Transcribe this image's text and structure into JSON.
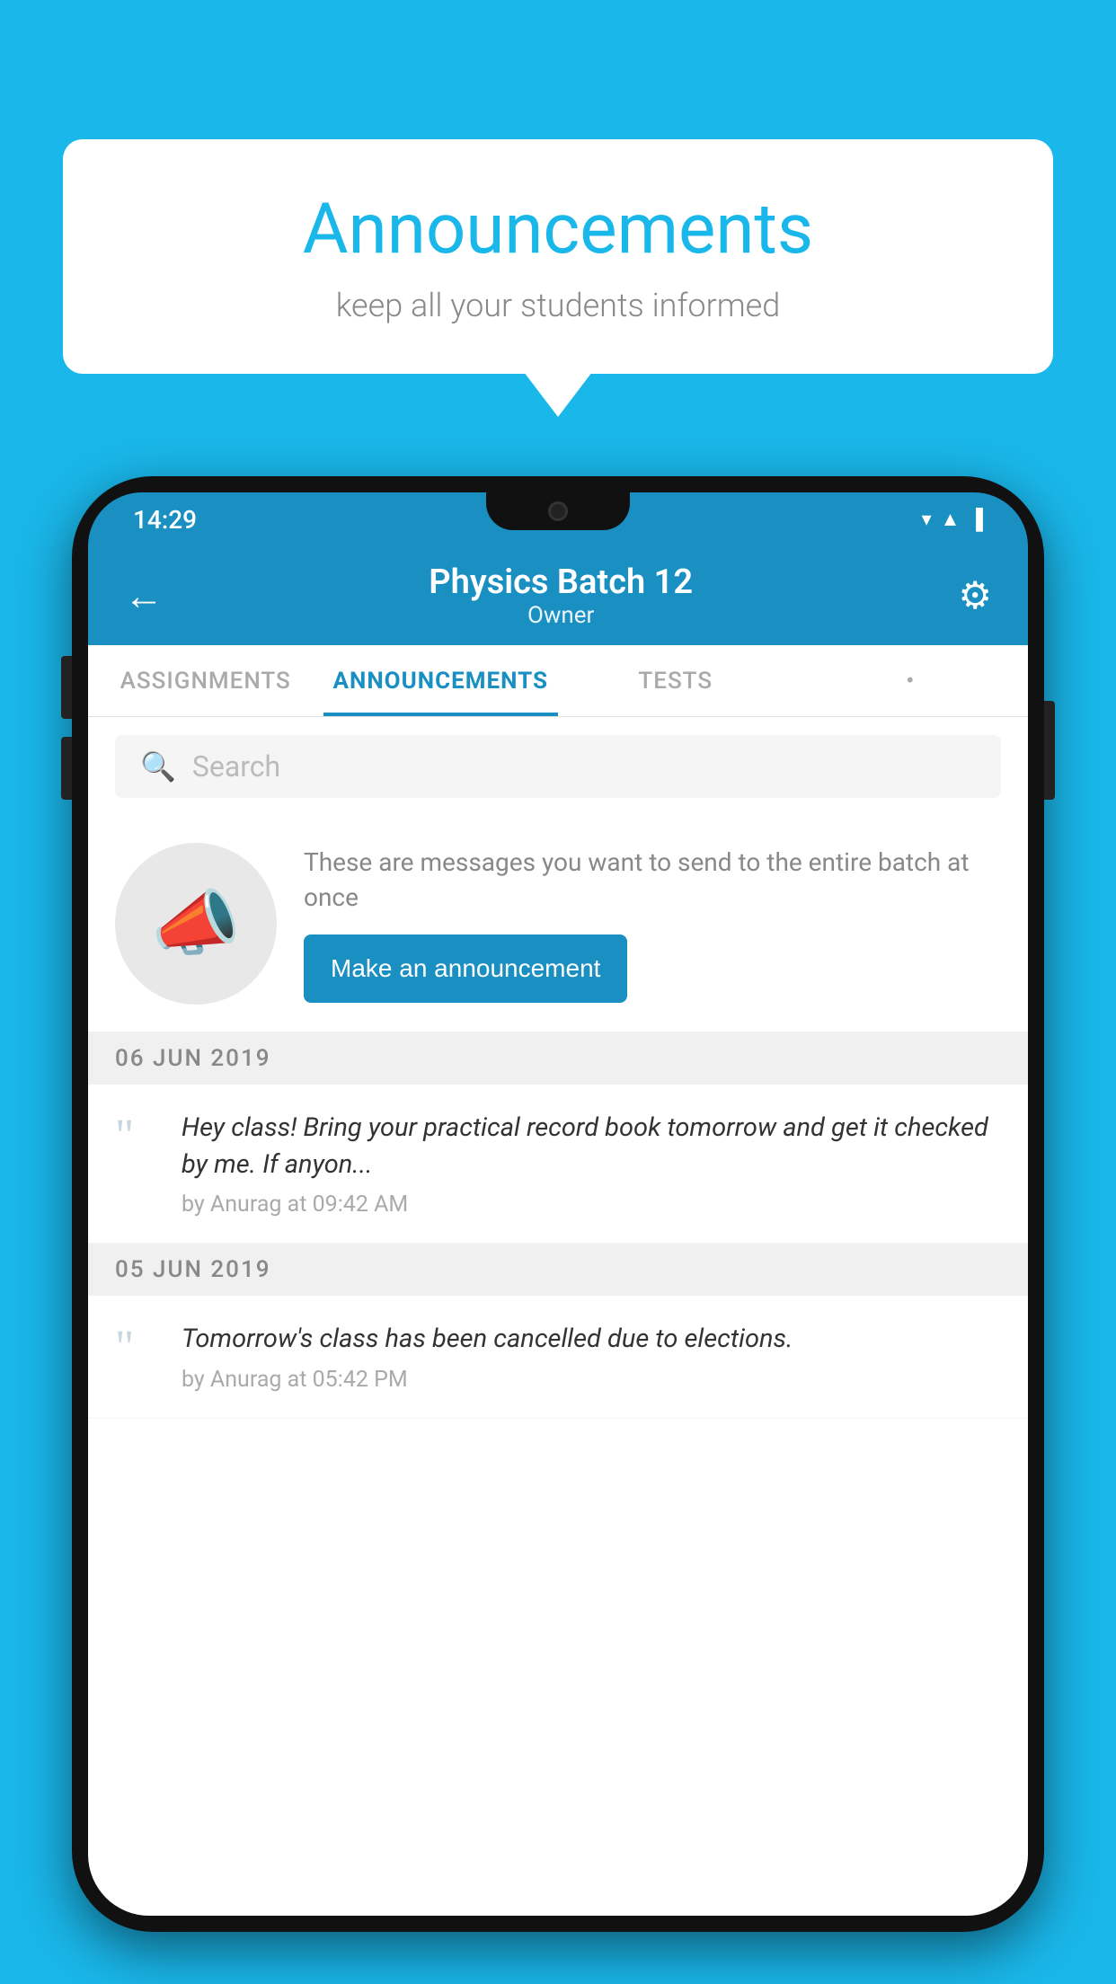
{
  "background_color": "#1ab7ea",
  "speech_bubble": {
    "title": "Announcements",
    "subtitle": "keep all your students informed"
  },
  "phone": {
    "status_bar": {
      "time": "14:29",
      "icons": [
        "wifi",
        "signal",
        "battery"
      ]
    },
    "header": {
      "back_label": "←",
      "title": "Physics Batch 12",
      "subtitle": "Owner",
      "gear_label": "⚙"
    },
    "tabs": [
      {
        "label": "ASSIGNMENTS",
        "active": false
      },
      {
        "label": "ANNOUNCEMENTS",
        "active": true
      },
      {
        "label": "TESTS",
        "active": false
      },
      {
        "label": "•",
        "active": false
      }
    ],
    "search": {
      "placeholder": "Search"
    },
    "announcement_prompt": {
      "description": "These are messages you want to send to the entire batch at once",
      "button_label": "Make an announcement"
    },
    "announcements": [
      {
        "date": "06  JUN  2019",
        "message": "Hey class! Bring your practical record book tomorrow and get it checked by me. If anyon...",
        "meta": "by Anurag at 09:42 AM"
      },
      {
        "date": "05  JUN  2019",
        "message": "Tomorrow's class has been cancelled due to elections.",
        "meta": "by Anurag at 05:42 PM"
      }
    ]
  }
}
